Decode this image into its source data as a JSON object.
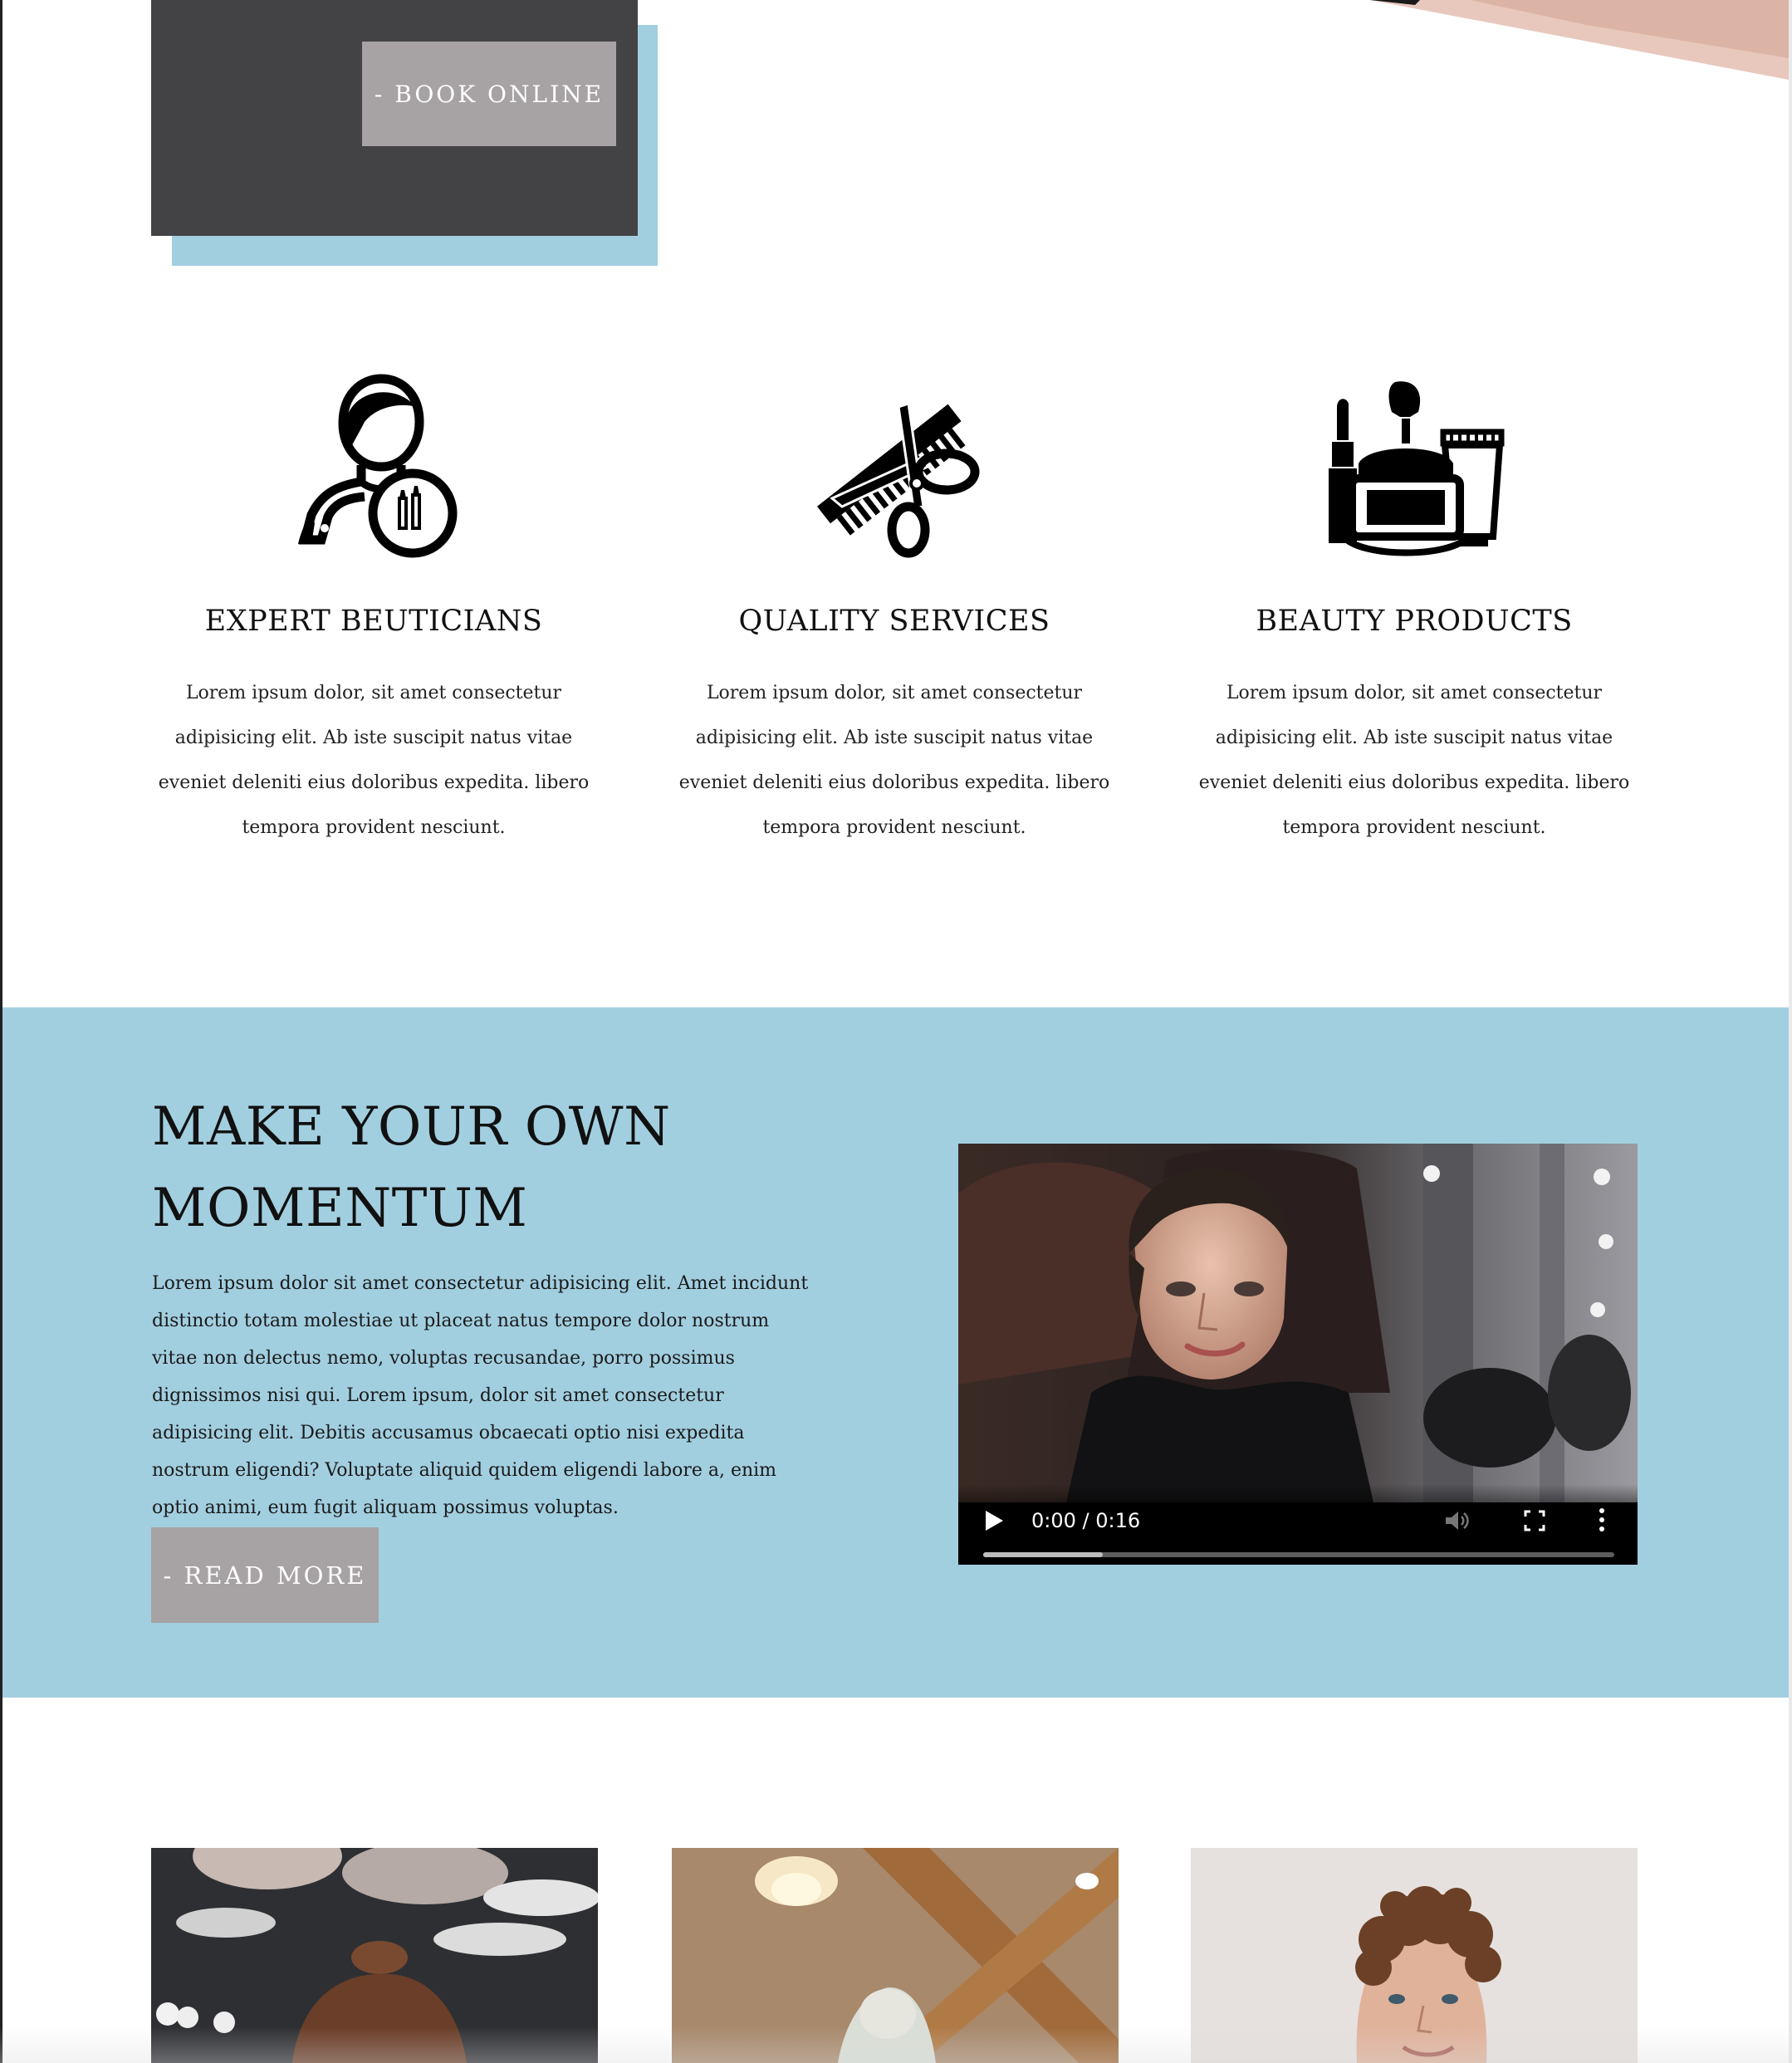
{
  "hero": {
    "book_button_label": "- BOOK ONLINE"
  },
  "features": [
    {
      "icon": "beautician-icon",
      "title": "EXPERT BEUTICIANS",
      "text": "Lorem ipsum dolor, sit amet consectetur adipisicing elit. Ab iste suscipit natus vitae eveniet deleniti eius doloribus expedita. libero tempora provident nesciunt."
    },
    {
      "icon": "comb-scissors-icon",
      "title": "QUALITY SERVICES",
      "text": "Lorem ipsum dolor, sit amet consectetur adipisicing elit. Ab iste suscipit natus vitae eveniet deleniti eius doloribus expedita. libero tempora provident nesciunt."
    },
    {
      "icon": "cosmetics-icon",
      "title": "BEAUTY PRODUCTS",
      "text": "Lorem ipsum dolor, sit amet consectetur adipisicing elit. Ab iste suscipit natus vitae eveniet deleniti eius doloribus expedita. libero tempora provident nesciunt."
    }
  ],
  "momentum": {
    "title_line1": "MAKE YOUR OWN",
    "title_line2": "MOMENTUM",
    "body": "Lorem ipsum dolor sit amet consectetur adipisicing elit. Amet incidunt distinctio totam molestiae ut placeat natus tempore dolor nostrum vitae non delectus nemo, voluptas recusandae, porro possimus dignissimos nisi qui. Lorem ipsum, dolor sit amet consectetur adipisicing elit. Debitis accusamus obcaecati optio nisi expedita nostrum eligendi? Voluptate aliquid quidem eligendi labore a, enim optio animi, eum fugit aliquam possimus voluptas.",
    "read_more_label": "- READ MORE",
    "video": {
      "time_display": "0:00 / 0:16",
      "buffered_fraction": 0.19
    }
  },
  "colors": {
    "accent_blue": "#a2cfe0",
    "dark_panel": "#434244",
    "button_grey": "#a7a2a3"
  }
}
